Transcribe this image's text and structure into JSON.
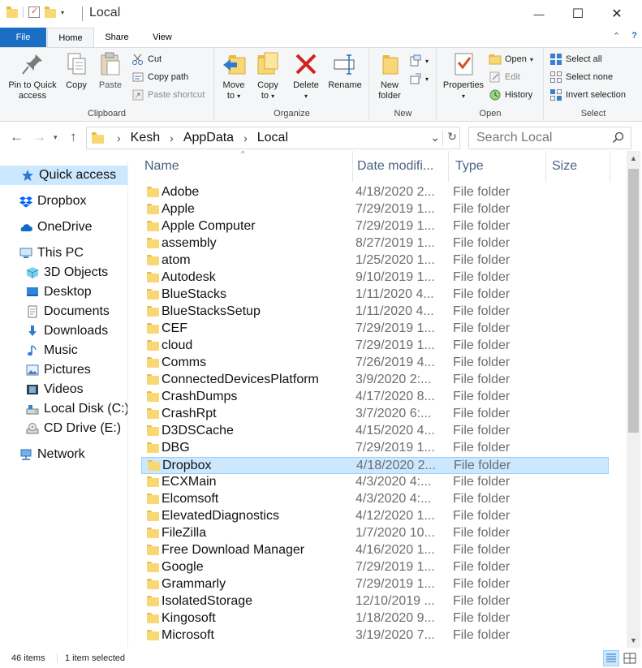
{
  "window": {
    "title": "Local",
    "minimize_glyph": "—",
    "maximize_glyph": "☐",
    "close_glyph": "✕"
  },
  "ribbon_tabs": {
    "file": "File",
    "home": "Home",
    "share": "Share",
    "view": "View",
    "collapse_glyph": "⌃",
    "help_glyph": "?"
  },
  "ribbon": {
    "clipboard": {
      "label": "Clipboard",
      "pin_line1": "Pin to Quick",
      "pin_line2": "access",
      "copy": "Copy",
      "paste": "Paste",
      "cut": "Cut",
      "copy_path": "Copy path",
      "paste_shortcut": "Paste shortcut"
    },
    "organize": {
      "label": "Organize",
      "move_to_line1": "Move",
      "move_to_line2": "to",
      "copy_to_line1": "Copy",
      "copy_to_line2": "to",
      "delete": "Delete",
      "rename": "Rename"
    },
    "new": {
      "label": "New",
      "new_folder_line1": "New",
      "new_folder_line2": "folder"
    },
    "open": {
      "label": "Open",
      "properties": "Properties",
      "open": "Open",
      "edit": "Edit",
      "history": "History"
    },
    "select": {
      "label": "Select",
      "select_all": "Select all",
      "select_none": "Select none",
      "invert_selection": "Invert selection"
    }
  },
  "address": {
    "crumbs": [
      "Kesh",
      "AppData",
      "Local"
    ],
    "search_placeholder": "Search Local"
  },
  "nav_pane": {
    "items": [
      {
        "label": "Quick access",
        "icon": "star-icon",
        "selected": true
      },
      {
        "label": "Dropbox",
        "icon": "dropbox-icon"
      },
      {
        "label": "OneDrive",
        "icon": "cloud-icon"
      },
      {
        "label": "This PC",
        "icon": "computer-icon"
      },
      {
        "label": "3D Objects",
        "icon": "cube-icon"
      },
      {
        "label": "Desktop",
        "icon": "desktop-icon"
      },
      {
        "label": "Documents",
        "icon": "document-icon"
      },
      {
        "label": "Downloads",
        "icon": "download-arrow-icon"
      },
      {
        "label": "Music",
        "icon": "music-note-icon"
      },
      {
        "label": "Pictures",
        "icon": "picture-icon"
      },
      {
        "label": "Videos",
        "icon": "film-icon"
      },
      {
        "label": "Local Disk (C:)",
        "icon": "hard-drive-icon"
      },
      {
        "label": "CD Drive (E:)",
        "icon": "cd-drive-icon"
      },
      {
        "label": "Network",
        "icon": "network-icon"
      }
    ]
  },
  "columns": {
    "name": "Name",
    "date": "Date modifi...",
    "type": "Type",
    "size": "Size"
  },
  "files": [
    {
      "name": "Adobe",
      "date": "4/18/2020 2...",
      "type": "File folder"
    },
    {
      "name": "Apple",
      "date": "7/29/2019 1...",
      "type": "File folder"
    },
    {
      "name": "Apple Computer",
      "date": "7/29/2019 1...",
      "type": "File folder"
    },
    {
      "name": "assembly",
      "date": "8/27/2019 1...",
      "type": "File folder"
    },
    {
      "name": "atom",
      "date": "1/25/2020 1...",
      "type": "File folder"
    },
    {
      "name": "Autodesk",
      "date": "9/10/2019 1...",
      "type": "File folder"
    },
    {
      "name": "BlueStacks",
      "date": "1/11/2020 4...",
      "type": "File folder"
    },
    {
      "name": "BlueStacksSetup",
      "date": "1/11/2020 4...",
      "type": "File folder"
    },
    {
      "name": "CEF",
      "date": "7/29/2019 1...",
      "type": "File folder"
    },
    {
      "name": "cloud",
      "date": "7/29/2019 1...",
      "type": "File folder"
    },
    {
      "name": "Comms",
      "date": "7/26/2019 4...",
      "type": "File folder"
    },
    {
      "name": "ConnectedDevicesPlatform",
      "date": "3/9/2020 2:...",
      "type": "File folder"
    },
    {
      "name": "CrashDumps",
      "date": "4/17/2020 8...",
      "type": "File folder"
    },
    {
      "name": "CrashRpt",
      "date": "3/7/2020 6:...",
      "type": "File folder"
    },
    {
      "name": "D3DSCache",
      "date": "4/15/2020 4...",
      "type": "File folder"
    },
    {
      "name": "DBG",
      "date": "7/29/2019 1...",
      "type": "File folder"
    },
    {
      "name": "Dropbox",
      "date": "4/18/2020 2...",
      "type": "File folder",
      "selected": true
    },
    {
      "name": "ECXMain",
      "date": "4/3/2020 4:...",
      "type": "File folder"
    },
    {
      "name": "Elcomsoft",
      "date": "4/3/2020 4:...",
      "type": "File folder"
    },
    {
      "name": "ElevatedDiagnostics",
      "date": "4/12/2020 1...",
      "type": "File folder"
    },
    {
      "name": "FileZilla",
      "date": "1/7/2020 10...",
      "type": "File folder"
    },
    {
      "name": "Free Download Manager",
      "date": "4/16/2020 1...",
      "type": "File folder"
    },
    {
      "name": "Google",
      "date": "7/29/2019 1...",
      "type": "File folder"
    },
    {
      "name": "Grammarly",
      "date": "7/29/2019 1...",
      "type": "File folder"
    },
    {
      "name": "IsolatedStorage",
      "date": "12/10/2019 ...",
      "type": "File folder"
    },
    {
      "name": "Kingosoft",
      "date": "1/18/2020 9...",
      "type": "File folder"
    },
    {
      "name": "Microsoft",
      "date": "3/19/2020 7...",
      "type": "File folder"
    }
  ],
  "status": {
    "item_count": "46 items",
    "selection": "1 item selected"
  },
  "colors": {
    "accent": "#1a6fc4",
    "selection": "#cce8ff",
    "selection_border": "#99d1ff",
    "folder": "#f8d775"
  }
}
